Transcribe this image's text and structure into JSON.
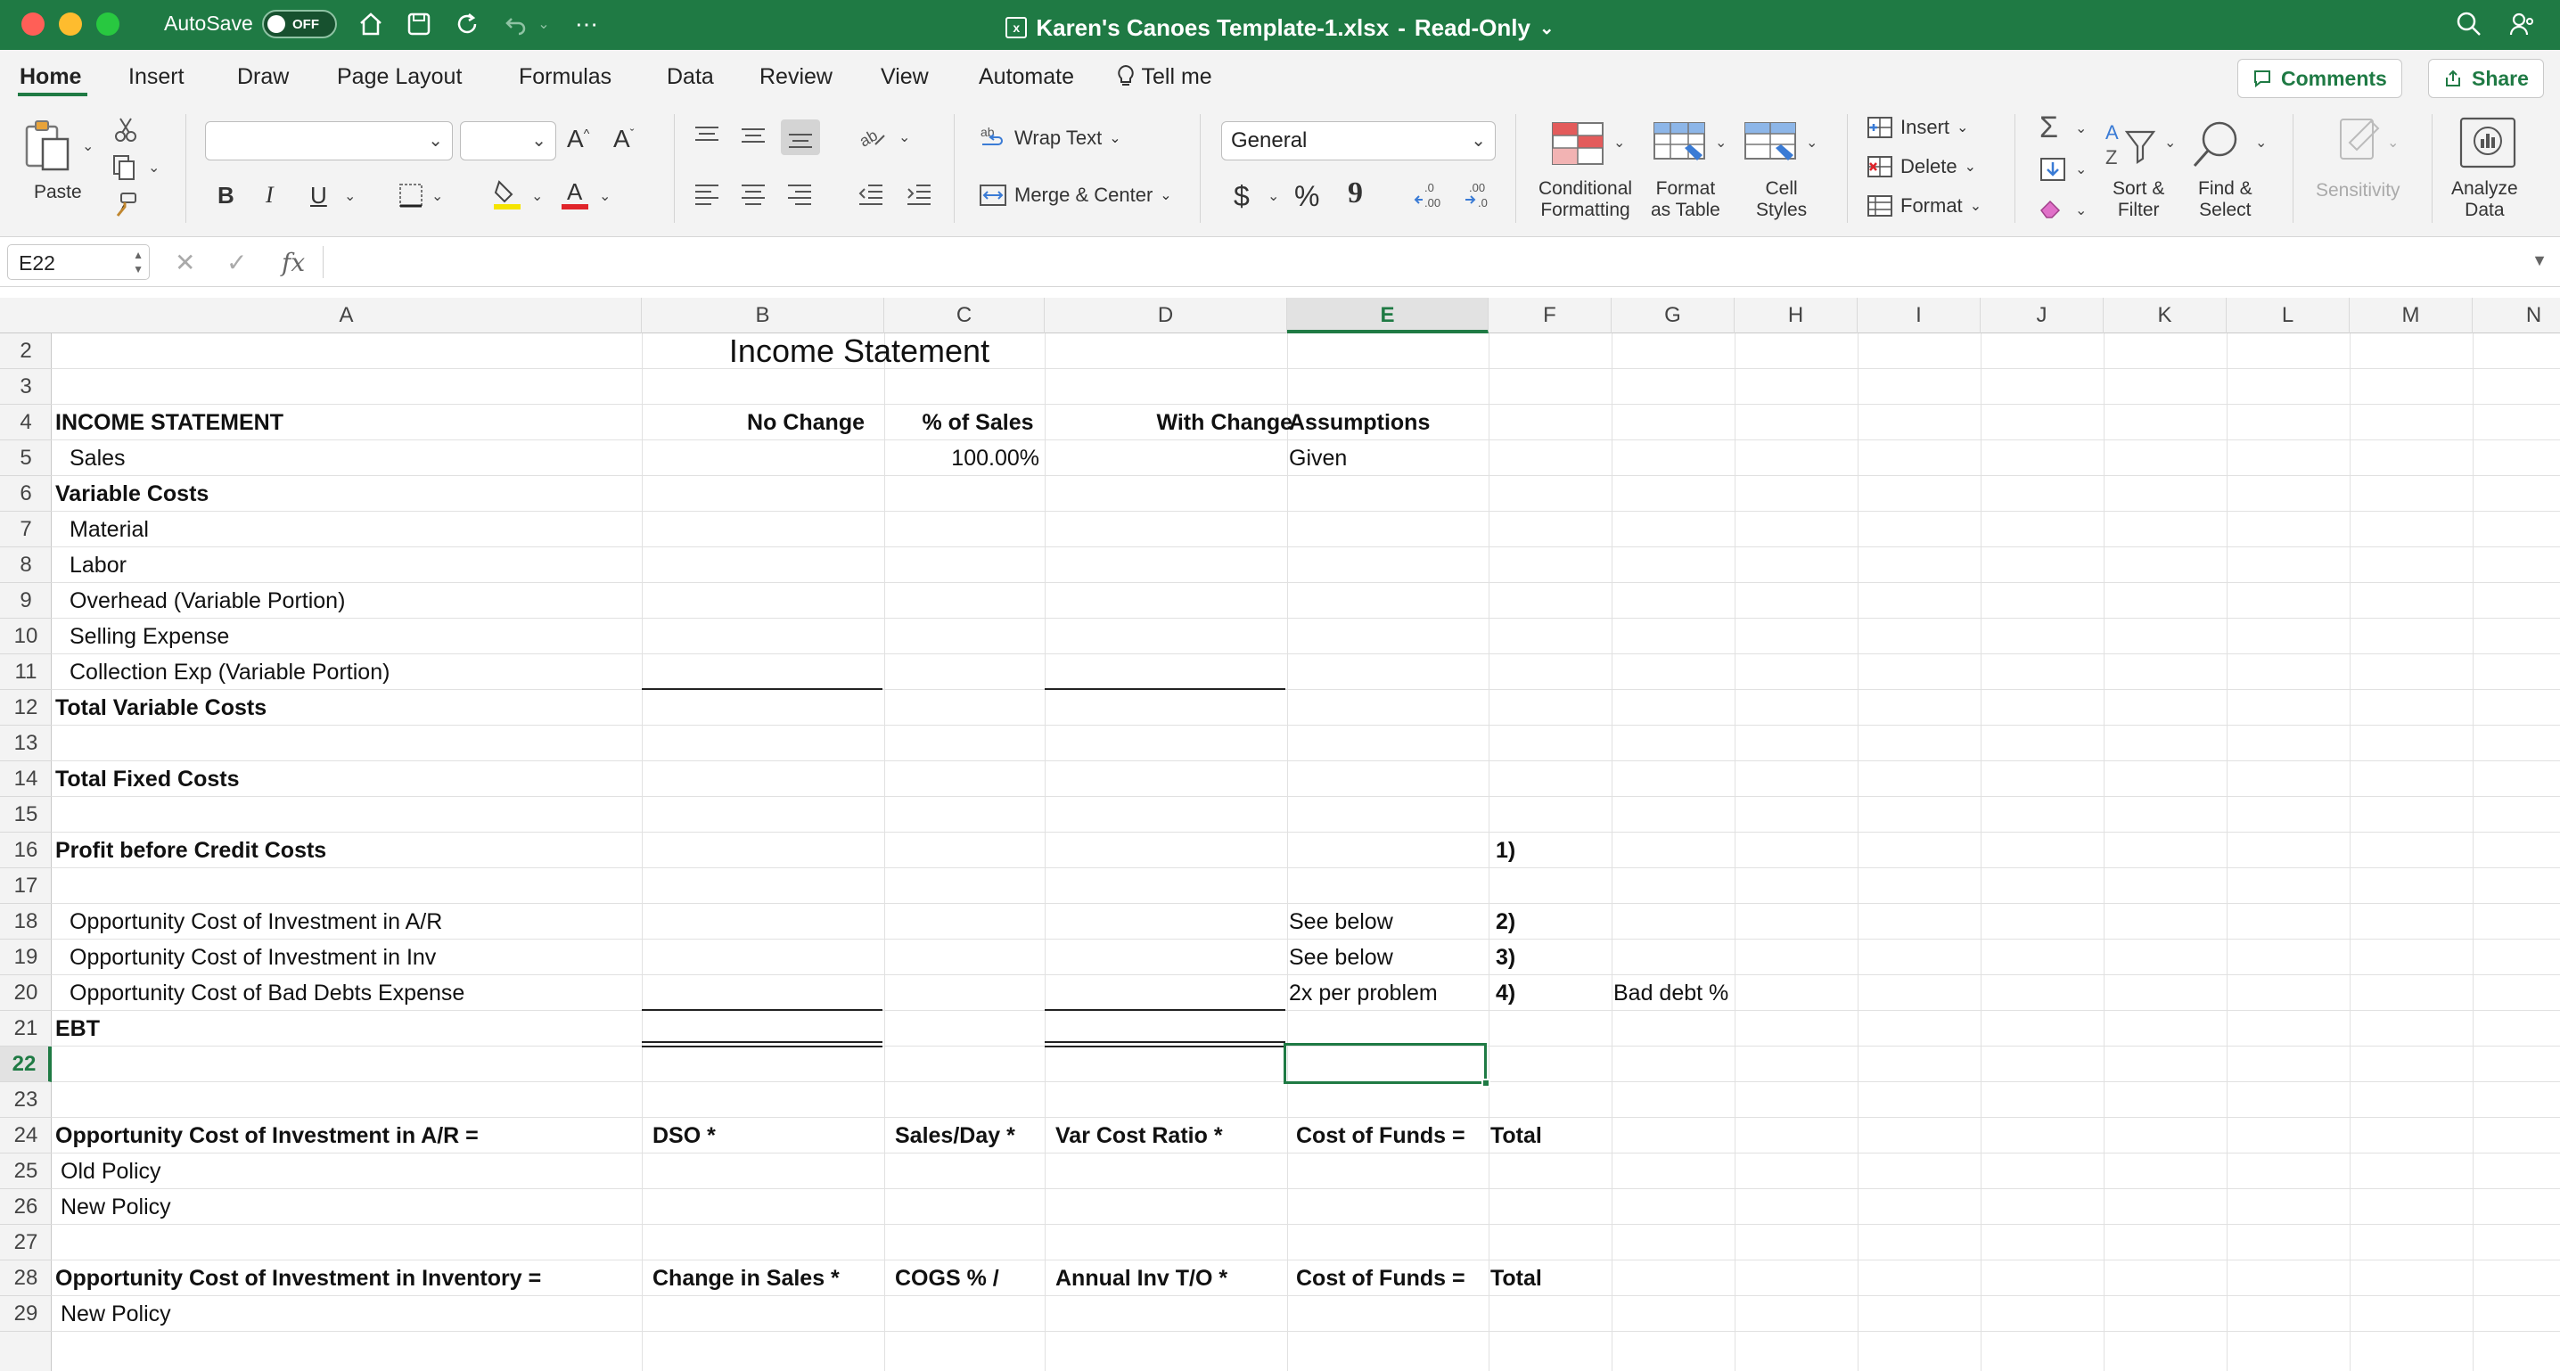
{
  "titlebar": {
    "autosave_label": "AutoSave",
    "autosave_state": "OFF",
    "document_title": "Karen's Canoes Template-1.xlsx",
    "separator": "-",
    "mode": "Read-Only"
  },
  "ribbon_tabs": [
    "Home",
    "Insert",
    "Draw",
    "Page Layout",
    "Formulas",
    "Data",
    "Review",
    "View",
    "Automate"
  ],
  "tell_me": "Tell me",
  "comments_label": "Comments",
  "share_label": "Share",
  "ribbon": {
    "paste": "Paste",
    "font_name": "",
    "font_size": "",
    "bold": "B",
    "italic": "I",
    "underline": "U",
    "wrap_text": "Wrap Text",
    "merge_center": "Merge & Center",
    "number_format": "General",
    "currency": "$",
    "percent": "%",
    "comma": "9",
    "conditional_formatting": [
      "Conditional",
      "Formatting"
    ],
    "format_as_table": [
      "Format",
      "as Table"
    ],
    "cell_styles": [
      "Cell",
      "Styles"
    ],
    "insert": "Insert",
    "delete": "Delete",
    "format": "Format",
    "sort_filter": [
      "Sort &",
      "Filter"
    ],
    "find_select": [
      "Find &",
      "Select"
    ],
    "sensitivity": "Sensitivity",
    "analyze_data": [
      "Analyze",
      "Data"
    ]
  },
  "formula_bar": {
    "name_box": "E22",
    "fx": "fx",
    "content": ""
  },
  "columns": [
    "A",
    "B",
    "C",
    "D",
    "E",
    "F",
    "G",
    "H",
    "I",
    "J",
    "K",
    "L",
    "M",
    "N"
  ],
  "selected_column": "E",
  "rows": [
    2,
    3,
    4,
    5,
    6,
    7,
    8,
    9,
    10,
    11,
    12,
    13,
    14,
    15,
    16,
    17,
    18,
    19,
    20,
    21,
    22,
    23,
    24,
    25,
    26,
    27,
    28,
    29
  ],
  "selected_row": 22,
  "sheet": {
    "title": "Income Statement",
    "r4": {
      "a": "INCOME STATEMENT",
      "b": "No Change",
      "c": "% of Sales",
      "d": "With Change",
      "e": "Assumptions"
    },
    "r5": {
      "a": "Sales",
      "c": "100.00%",
      "e": "Given"
    },
    "r6": {
      "a": "Variable Costs"
    },
    "r7": {
      "a": "Material"
    },
    "r8": {
      "a": "Labor"
    },
    "r9": {
      "a": "Overhead (Variable Portion)"
    },
    "r10": {
      "a": "Selling Expense"
    },
    "r11": {
      "a": "Collection Exp (Variable Portion)"
    },
    "r12": {
      "a": "Total Variable Costs"
    },
    "r14": {
      "a": "Total Fixed Costs"
    },
    "r16": {
      "a": "Profit before Credit Costs",
      "f": "1)"
    },
    "r18": {
      "a": "Opportunity Cost of Investment in A/R",
      "e": "See below",
      "f": "2)"
    },
    "r19": {
      "a": "Opportunity Cost of Investment in Inv",
      "e": "See below",
      "f": "3)"
    },
    "r20": {
      "a": "Opportunity Cost of Bad Debts Expense",
      "e": "2x per problem",
      "f": "4)",
      "g": "Bad debt %"
    },
    "r21": {
      "a": "EBT"
    },
    "r24": {
      "a": "Opportunity Cost of Investment in A/R =",
      "b": "DSO *",
      "c": "Sales/Day *",
      "d": "Var Cost Ratio *",
      "e": "Cost of Funds =",
      "f": "Total"
    },
    "r25": {
      "a": "Old Policy"
    },
    "r26": {
      "a": "New Policy"
    },
    "r28": {
      "a": "Opportunity Cost of Investment in Inventory =",
      "b": "Change in Sales *",
      "c": "COGS % /",
      "d": "Annual Inv T/O *",
      "e": "Cost of Funds =",
      "f": "Total"
    },
    "r29": {
      "a": "New Policy"
    }
  },
  "colors": {
    "titlebar": "#1f7a44",
    "accent": "#1f7a44",
    "ribbon_bg": "#f3f3f3",
    "gridline": "#e1e1e1"
  }
}
